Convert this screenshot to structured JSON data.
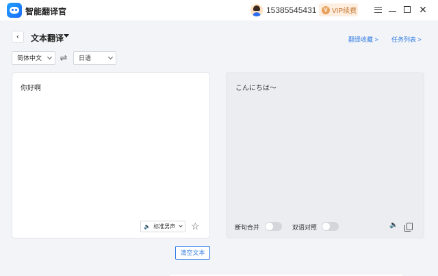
{
  "app": {
    "name": "智能翻译官"
  },
  "user": {
    "phone": "15385545431"
  },
  "vip": {
    "icon_text": "V",
    "label": "VIP续费"
  },
  "header": {
    "title": "文本翻译",
    "links": {
      "favorites": "翻译收藏 >",
      "tasks": "任务列表 >"
    }
  },
  "languages": {
    "source": "简体中文",
    "target": "日语"
  },
  "source_panel": {
    "text": "你好啊",
    "voice": "标准男声"
  },
  "target_panel": {
    "text": "こんにちは～",
    "toggle_merge": "断句合并",
    "toggle_bilingual": "双语对照"
  },
  "actions": {
    "clear": "清空文本"
  },
  "icons": {
    "back": "‹",
    "swap": "⇌",
    "speaker": "🔈",
    "star": "☆",
    "close": "✕"
  }
}
